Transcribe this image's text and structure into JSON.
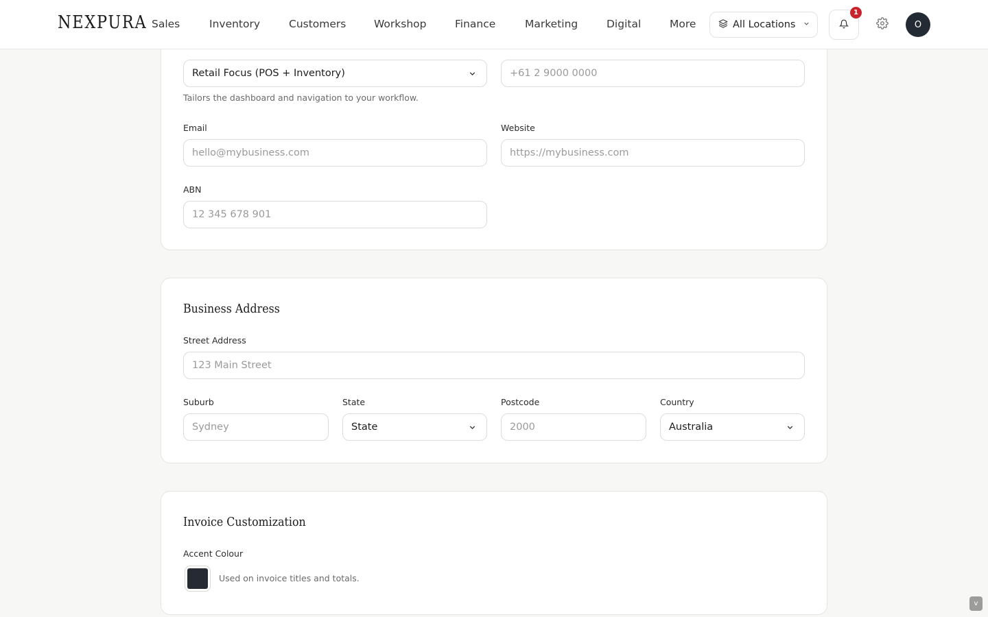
{
  "app": {
    "logo": "NEXPURA"
  },
  "nav": {
    "items": [
      {
        "label": "Sales"
      },
      {
        "label": "Inventory"
      },
      {
        "label": "Customers"
      },
      {
        "label": "Workshop"
      },
      {
        "label": "Finance"
      },
      {
        "label": "Marketing"
      },
      {
        "label": "Digital"
      },
      {
        "label": "More"
      }
    ],
    "location_label": "All Locations",
    "notification_count": "1",
    "avatar_initial": "O"
  },
  "business_details": {
    "focus_value": "Retail Focus (POS + Inventory)",
    "focus_help": "Tailors the dashboard and navigation to your workflow.",
    "phone_placeholder": "+61 2 9000 0000",
    "email_label": "Email",
    "email_placeholder": "hello@mybusiness.com",
    "website_label": "Website",
    "website_placeholder": "https://mybusiness.com",
    "abn_label": "ABN",
    "abn_placeholder": "12 345 678 901"
  },
  "business_address": {
    "title": "Business Address",
    "street_label": "Street Address",
    "street_placeholder": "123 Main Street",
    "suburb_label": "Suburb",
    "suburb_placeholder": "Sydney",
    "state_label": "State",
    "state_value": "State",
    "postcode_label": "Postcode",
    "postcode_placeholder": "2000",
    "country_label": "Country",
    "country_value": "Australia"
  },
  "invoice": {
    "title": "Invoice Customization",
    "accent_label": "Accent Colour",
    "accent_color": "#262b33",
    "accent_help": "Used on invoice titles and totals."
  },
  "scroll_indicator": "v"
}
